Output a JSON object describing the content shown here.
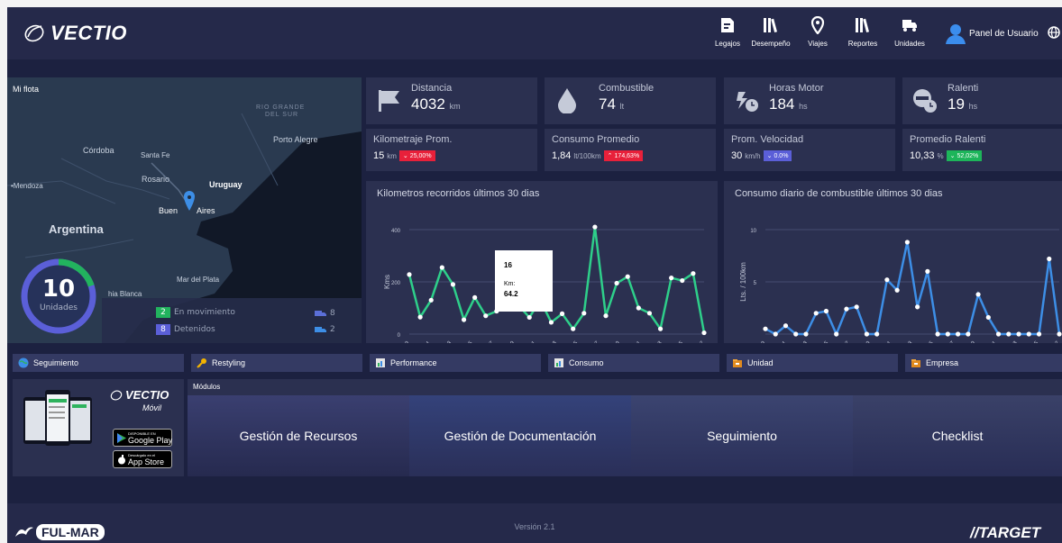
{
  "header": {
    "brand": "VECTIO",
    "nav": [
      {
        "label": "Legajos",
        "icon": "badge-icon"
      },
      {
        "label": "Desempeño",
        "icon": "books-icon"
      },
      {
        "label": "Viajes",
        "icon": "map-pin-icon"
      },
      {
        "label": "Reportes",
        "icon": "books-icon"
      },
      {
        "label": "Unidades",
        "icon": "truck-icon"
      }
    ],
    "user_label": "Panel de Usuario"
  },
  "map": {
    "title": "Mi flota",
    "labels": {
      "rio_grande_1": "RIO GRANDE",
      "rio_grande_2": "DEL SUR",
      "porto_alegre": "Porto Alegre",
      "cordoba": "Córdoba",
      "santa_fe": "Santa Fe",
      "rosario": "Rosario",
      "uruguay": "Uruguay",
      "mendoza": "•Mendoza",
      "buenos_aires_1": "Buen",
      "buenos_aires_2": "Aires",
      "argentina": "Argentina",
      "mar_del_plata": "Mar del Plata",
      "bahia_blanca": "hia Blanca"
    },
    "fleet": {
      "total": "10",
      "total_label": "Unidades",
      "moving_fraction": 0.2
    }
  },
  "status": {
    "moving_count": "2",
    "moving_label": "En movimiento",
    "stopped_count": "8",
    "stopped_label": "Detenidos",
    "icon_moving_count": "8",
    "icon_stopped_count": "2"
  },
  "kpis": [
    {
      "title": "Distancia",
      "value": "4032",
      "unit": "km",
      "icon": "flag-icon"
    },
    {
      "title": "Combustible",
      "value": "74",
      "unit": "lt",
      "icon": "fuel-drop-icon"
    },
    {
      "title": "Horas Motor",
      "value": "184",
      "unit": "hs",
      "icon": "engine-clock-icon"
    },
    {
      "title": "Ralenti",
      "value": "19",
      "unit": "hs",
      "icon": "idle-clock-icon"
    }
  ],
  "averages": [
    {
      "title": "Kilometraje Prom.",
      "value": "15",
      "unit": "km",
      "delta": "25,00%",
      "dir": "down",
      "color": "#e8203a"
    },
    {
      "title": "Consumo Promedio",
      "value": "1,84",
      "unit": "lt/100km",
      "delta": "174,63%",
      "dir": "up",
      "color": "#e8203a"
    },
    {
      "title": "Prom. Velocidad",
      "value": "30",
      "unit": "km/h",
      "delta": "0.0%",
      "dir": "down",
      "color": "#5b5fd8"
    },
    {
      "title": "Promedio Ralenti",
      "value": "10,33",
      "unit": "%",
      "delta": "52,02%",
      "dir": "down",
      "color": "#1db55a"
    }
  ],
  "chart_km": {
    "title": "Kilometros recorridos últimos 30 dias",
    "tooltip": {
      "day": "16",
      "label": "Km:",
      "value": "64.2"
    }
  },
  "chart_fuel": {
    "title": "Consumo diario de combustible últimos 30 dias"
  },
  "chart_data": [
    {
      "type": "line",
      "title": "Kilometros recorridos últimos 30 dias",
      "ylabel": "Kms",
      "ylim": [
        0,
        400
      ],
      "yticks": [
        "0",
        "200",
        "400"
      ],
      "xticks": [
        "09",
        "11",
        "13",
        "15",
        "17",
        "19",
        "21",
        "23",
        "25",
        "27",
        "29",
        "01",
        "03",
        "05",
        "07"
      ],
      "color": "#2ecf8a",
      "values": [
        228,
        65,
        130,
        255,
        190,
        55,
        140,
        70,
        88,
        200,
        110,
        64,
        130,
        45,
        78,
        20,
        80,
        410,
        70,
        195,
        220,
        100,
        80,
        20,
        215,
        205,
        232,
        5
      ]
    },
    {
      "type": "line",
      "title": "Consumo diario de combustible últimos 30 dias",
      "ylabel": "Lts. / 100km",
      "ylim": [
        0,
        10
      ],
      "yticks": [
        "",
        "5",
        "10"
      ],
      "xticks": [
        "09",
        "11",
        "13",
        "15",
        "17",
        "19",
        "21",
        "23",
        "25",
        "27",
        "29",
        "01",
        "03",
        "05",
        "07"
      ],
      "color": "#3d8ee6",
      "values": [
        0.5,
        0,
        0.8,
        0,
        0,
        2.0,
        2.2,
        0,
        2.4,
        2.6,
        0,
        0,
        5.2,
        4.2,
        8.8,
        2.6,
        6.0,
        0,
        0,
        0,
        0,
        3.8,
        1.6,
        0,
        0,
        0,
        0,
        0,
        7.2,
        0
      ]
    }
  ],
  "quick_tabs": [
    {
      "label": "Seguimiento",
      "icon": "globe-icon"
    },
    {
      "label": "Restyling",
      "icon": "key-icon"
    },
    {
      "label": "Performance",
      "icon": "chart-doc-icon"
    },
    {
      "label": "Consumo",
      "icon": "chart-doc-icon"
    },
    {
      "label": "Unidad",
      "icon": "folder-icon"
    },
    {
      "label": "Empresa",
      "icon": "folder-icon"
    }
  ],
  "promo": {
    "brand": "VECTIO",
    "sub": "Móvil",
    "google_small": "DISPONIBLE EN",
    "google_big": "Google Play",
    "apple_small": "Descárgalo en el",
    "apple_big": "App Store"
  },
  "modules": {
    "title": "Módulos",
    "items": [
      "Gestión de Recursos",
      "Gestión de Documentación",
      "Seguimiento",
      "Checklist"
    ]
  },
  "footer": {
    "version": "Versión 2.1",
    "left_brand": "FUL-MAR",
    "right_brand": "TARGET"
  }
}
